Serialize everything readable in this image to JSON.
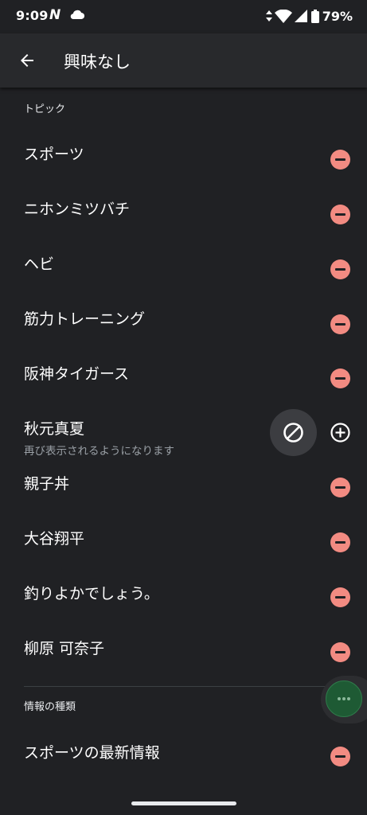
{
  "status_bar": {
    "time": "9:09",
    "n_icon": "N",
    "battery": "79%",
    "icons": [
      "cloud-icon",
      "data-arrows-icon",
      "wifi-icon",
      "signal-icon",
      "battery-icon"
    ]
  },
  "app_bar": {
    "title": "興味なし",
    "back_icon": "arrow-back-icon"
  },
  "sections": {
    "topics_header": "トピック",
    "info_types_header": "情報の種類"
  },
  "topics": [
    {
      "label": "スポーツ",
      "action": "remove"
    },
    {
      "label": "ニホンミツバチ",
      "action": "remove"
    },
    {
      "label": "ヘビ",
      "action": "remove"
    },
    {
      "label": "筋力トレーニング",
      "action": "remove"
    },
    {
      "label": "阪神タイガース",
      "action": "remove"
    },
    {
      "label": "秋元真夏",
      "sub": "再び表示されるようになります",
      "action": "add"
    },
    {
      "label": "親子丼",
      "action": "remove"
    },
    {
      "label": "大谷翔平",
      "action": "remove"
    },
    {
      "label": "釣りよかでしょう。",
      "action": "remove"
    },
    {
      "label": "柳原 可奈子",
      "action": "remove"
    }
  ],
  "info_types": [
    {
      "label": "スポーツの最新情報",
      "action": "remove"
    }
  ],
  "colors": {
    "background": "#202124",
    "app_bar": "#28292c",
    "remove_accent": "#f28b82",
    "fab": "#1e5a34"
  }
}
